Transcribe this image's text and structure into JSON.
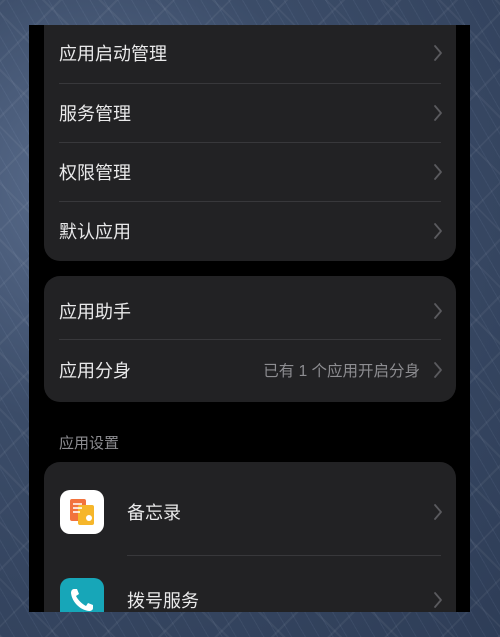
{
  "group1": [
    {
      "label": "应用启动管理"
    },
    {
      "label": "服务管理"
    },
    {
      "label": "权限管理"
    },
    {
      "label": "默认应用"
    }
  ],
  "group2": [
    {
      "label": "应用助手"
    },
    {
      "label": "应用分身",
      "value": "已有 1 个应用开启分身"
    }
  ],
  "app_settings": {
    "title": "应用设置",
    "apps": [
      {
        "label": "备忘录",
        "icon": "memo-icon"
      },
      {
        "label": "拨号服务",
        "icon": "phone-icon"
      }
    ]
  }
}
